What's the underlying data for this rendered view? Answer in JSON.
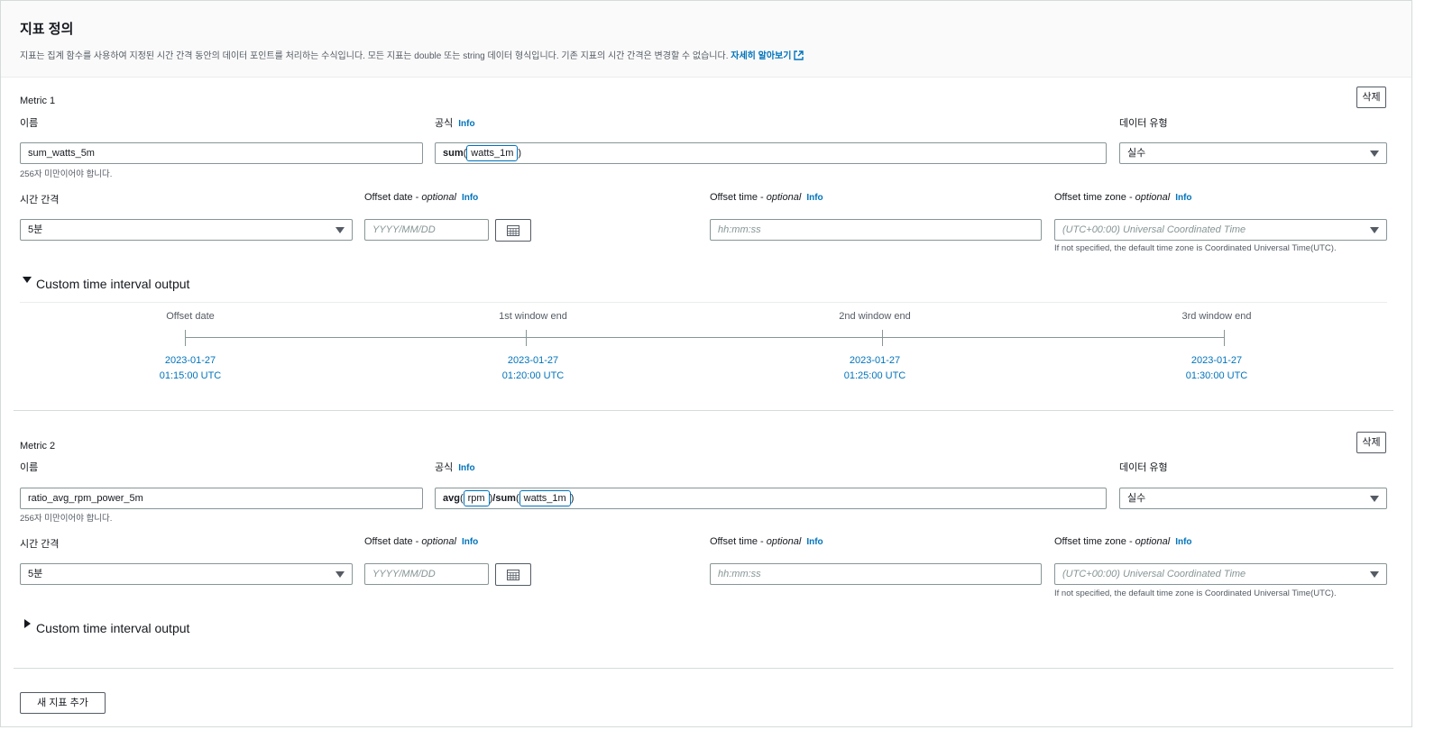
{
  "header": {
    "title": "지표 정의",
    "description": "지표는 집계 함수를 사용하여 지정된 시간 간격 동안의 데이터 포인트를 처리하는 수식입니다. 모든 지표는 double 또는 string 데이터 형식입니다. 기존 지표의 시간 간격은 변경할 수 없습니다.",
    "learn_more": "자세히 알아보기"
  },
  "labels": {
    "name": "이름",
    "formula": "공식",
    "data_type": "데이터 유형",
    "interval": "시간 간격",
    "offset_date": "Offset date",
    "offset_time": "Offset time",
    "offset_tz": "Offset time zone",
    "optional": "optional",
    "info": "Info",
    "delete": "삭제",
    "name_hint": "256자 미만이어야 합니다.",
    "tz_hint": "If not specified, the default time zone is Coordinated Universal Time(UTC).",
    "date_placeholder": "YYYY/MM/DD",
    "time_placeholder": "hh:mm:ss",
    "tz_placeholder": "(UTC+00:00) Universal Coordinated Time",
    "custom_output": "Custom time interval output"
  },
  "metrics": [
    {
      "title": "Metric 1",
      "name": "sum_watts_5m",
      "formula": [
        {
          "fn": "sum",
          "arg": "watts_1m"
        }
      ],
      "data_type": "실수",
      "interval": "5분",
      "timeline": {
        "labels": [
          "Offset date",
          "1st window end",
          "2nd window end",
          "3rd window end"
        ],
        "dates": [
          "2023-01-27",
          "2023-01-27",
          "2023-01-27",
          "2023-01-27"
        ],
        "times": [
          "01:15:00 UTC",
          "01:20:00 UTC",
          "01:25:00 UTC",
          "01:30:00 UTC"
        ]
      }
    },
    {
      "title": "Metric 2",
      "name": "ratio_avg_rpm_power_5m",
      "formula": [
        {
          "fn": "avg",
          "arg": "rpm"
        },
        {
          "op": "/"
        },
        {
          "fn": "sum",
          "arg": "watts_1m"
        }
      ],
      "data_type": "실수",
      "interval": "5분"
    }
  ],
  "add_button": "새 지표 추가"
}
